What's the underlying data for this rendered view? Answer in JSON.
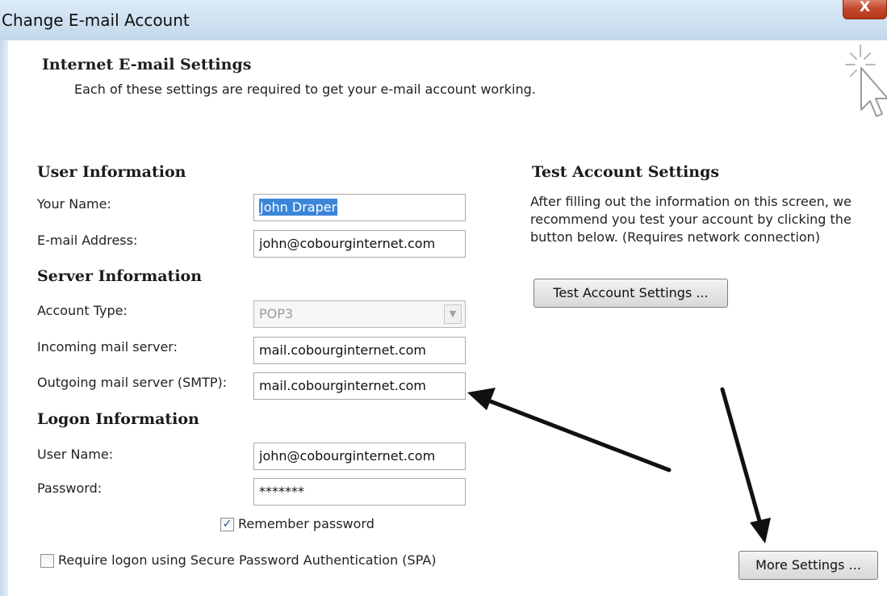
{
  "window": {
    "title": "Change E-mail Account",
    "close_glyph": "X"
  },
  "header": {
    "title": "Internet E-mail Settings",
    "subtitle": "Each of these settings are required to get your e-mail account working.",
    "icon": "wizard-cursor-icon"
  },
  "user_info": {
    "heading": "User Information",
    "name_label": "Your Name:",
    "name_value": "John Draper",
    "email_label": "E-mail Address:",
    "email_value": "john@cobourginternet.com"
  },
  "server_info": {
    "heading": "Server Information",
    "account_type_label": "Account Type:",
    "account_type_value": "POP3",
    "incoming_label": "Incoming mail server:",
    "incoming_value": "mail.cobourginternet.com",
    "outgoing_label": "Outgoing mail server (SMTP):",
    "outgoing_value": "mail.cobourginternet.com"
  },
  "logon_info": {
    "heading": "Logon Information",
    "username_label": "User Name:",
    "username_value": "john@cobourginternet.com",
    "password_label": "Password:",
    "password_value": "*******",
    "remember_label": "Remember password",
    "remember_checked": true,
    "spa_label": "Require logon using Secure Password Authentication (SPA)",
    "spa_checked": false
  },
  "test_settings": {
    "heading": "Test Account Settings",
    "description": "After filling out the information on this screen, we recommend you test your account by clicking the button below. (Requires network connection)",
    "test_button": "Test Account Settings ...",
    "more_button": "More Settings ..."
  },
  "colors": {
    "selection": "#3b86d8",
    "titlebar": "#c3d8ec",
    "close": "#c34a2c",
    "arrow": "#111111"
  }
}
